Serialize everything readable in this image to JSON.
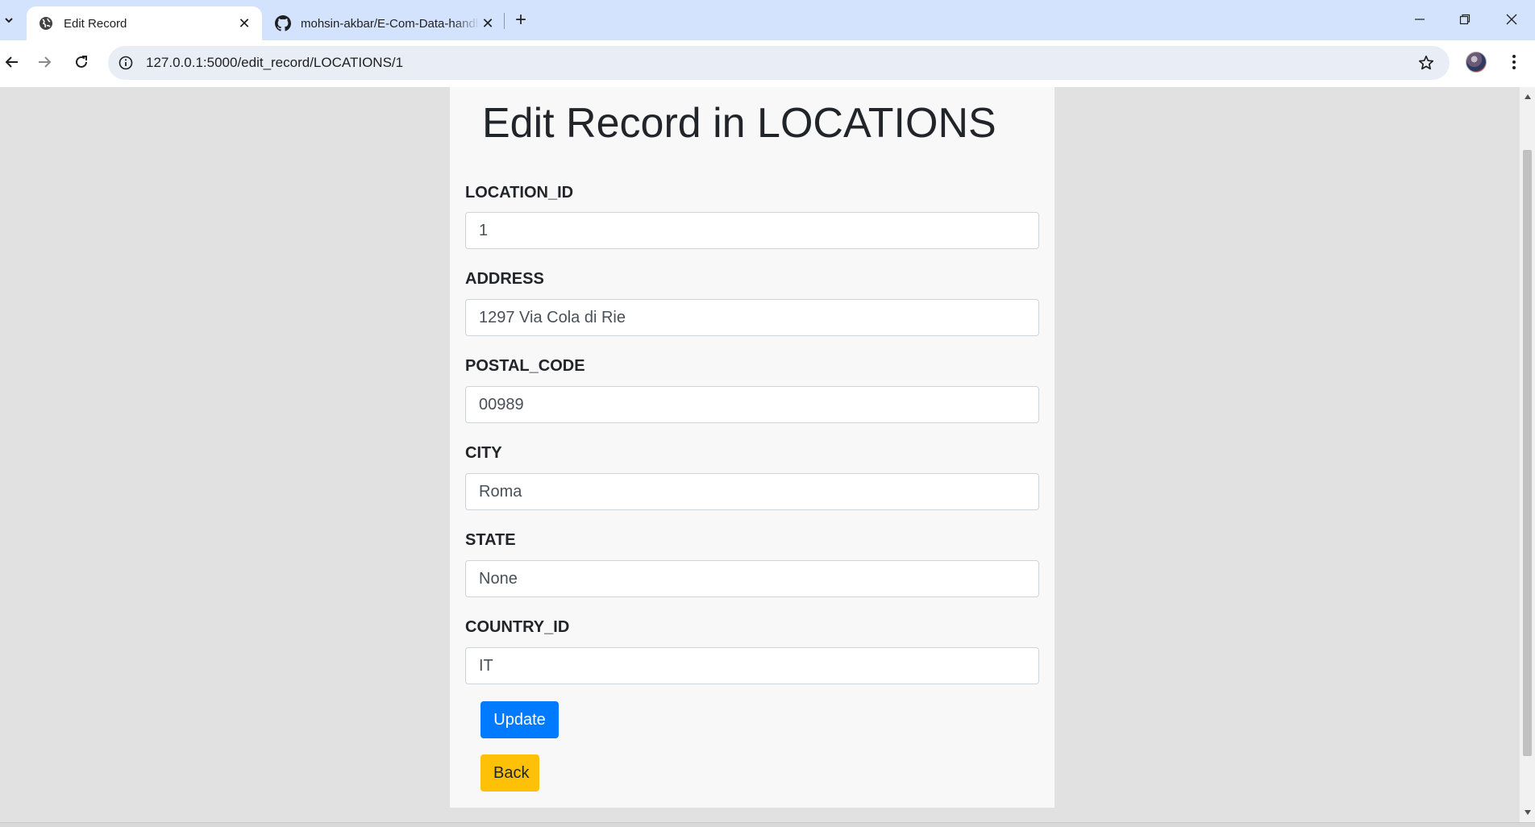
{
  "browser": {
    "tabs": [
      {
        "title": "Edit Record",
        "active": true,
        "favicon": "globe-icon"
      },
      {
        "title": "mohsin-akbar/E-Com-Data-handling",
        "active": false,
        "favicon": "github-icon"
      }
    ],
    "url": "127.0.0.1:5000/edit_record/LOCATIONS/1"
  },
  "page": {
    "title": "Edit Record in LOCATIONS",
    "fields": [
      {
        "label": "LOCATION_ID",
        "value": "1"
      },
      {
        "label": "ADDRESS",
        "value": "1297 Via Cola di Rie"
      },
      {
        "label": "POSTAL_CODE",
        "value": "00989"
      },
      {
        "label": "CITY",
        "value": "Roma"
      },
      {
        "label": "STATE",
        "value": "None"
      },
      {
        "label": "COUNTRY_ID",
        "value": "IT"
      }
    ],
    "buttons": {
      "update": "Update",
      "back": "Back"
    }
  },
  "colors": {
    "primary": "#007bff",
    "warning": "#ffc107",
    "tabstrip": "#d3e3fd",
    "page_background": "#e1e1e1",
    "card_background": "#f8f8f8"
  }
}
